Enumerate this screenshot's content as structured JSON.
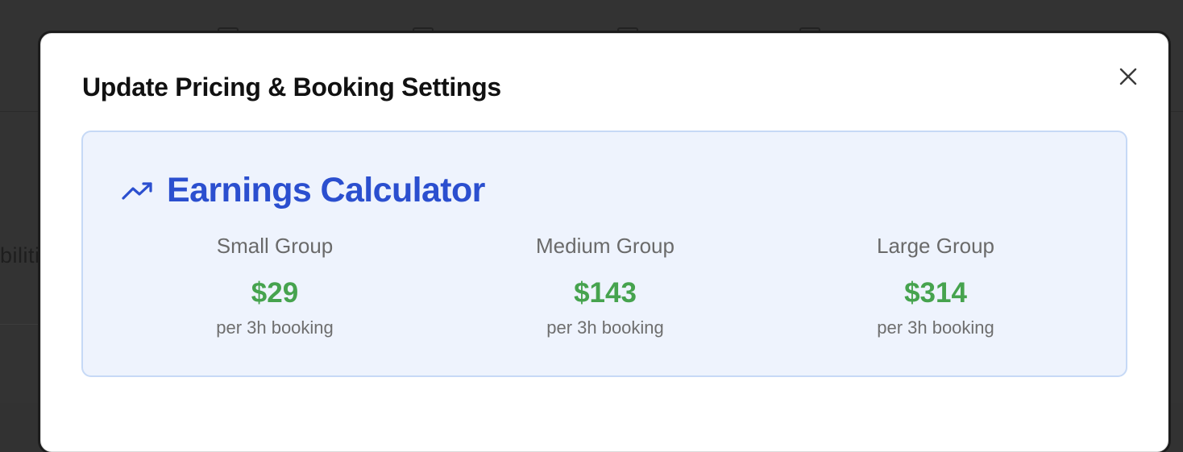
{
  "background": {
    "peek_text": "biliti"
  },
  "modal": {
    "title": "Update Pricing & Booking Settings",
    "close_icon": "close-icon"
  },
  "earnings_calculator": {
    "icon": "trending-up-icon",
    "title": "Earnings Calculator",
    "groups": [
      {
        "name": "Small Group",
        "price": "$29",
        "note": "per 3h booking"
      },
      {
        "name": "Medium Group",
        "price": "$143",
        "note": "per 3h booking"
      },
      {
        "name": "Large Group",
        "price": "$314",
        "note": "per 3h booking"
      }
    ]
  },
  "colors": {
    "accent_blue": "#2b4fcf",
    "price_green": "#46a34e",
    "card_background": "#eef3fd",
    "card_border": "#c6d9f6"
  }
}
